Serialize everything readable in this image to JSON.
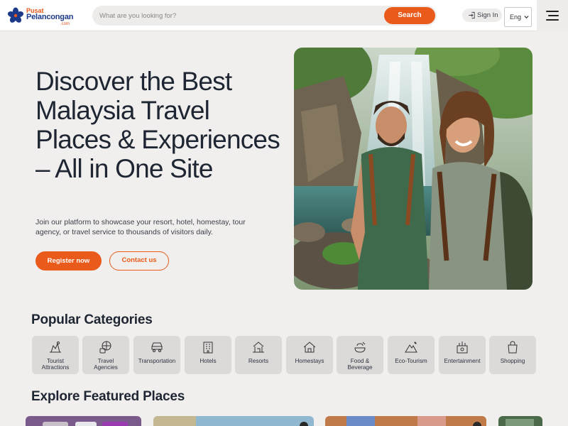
{
  "header": {
    "logo": {
      "line1": "Pusat",
      "line2": "Pelancongan",
      "line3": ".com"
    },
    "search": {
      "placeholder": "What are you looking for?",
      "button_label": "Search"
    },
    "signin_label": "Sign In",
    "language": {
      "selected": "Eng"
    },
    "icons": {
      "menu": "hamburger-menu-icon",
      "signin": "sign-in-icon",
      "dropdown": "chevron-down-icon",
      "logo": "hibiscus-icon"
    }
  },
  "hero": {
    "title": "Discover the Best Malaysia Travel Places & Experiences – All in One Site",
    "subtitle": "Join our platform to showcase your resort, hotel, homestay, tour agency, or travel service to thousands of visitors daily.",
    "register_label": "Register now",
    "contact_label": "Contact us"
  },
  "categories": {
    "title": "Popular Categories",
    "items": [
      {
        "line1": "Tourist",
        "line2": "Attractions",
        "icon": "attractions-icon"
      },
      {
        "line1": "Travel",
        "line2": "Agencies",
        "icon": "travel-agency-icon"
      },
      {
        "line1": "Transportation",
        "line2": "",
        "icon": "car-icon"
      },
      {
        "line1": "Hotels",
        "line2": "",
        "icon": "hotel-icon"
      },
      {
        "line1": "Resorts",
        "line2": "",
        "icon": "resort-icon"
      },
      {
        "line1": "Homestays",
        "line2": "",
        "icon": "homestay-icon"
      },
      {
        "line1": "Food &",
        "line2": "Beverage",
        "icon": "food-icon"
      },
      {
        "line1": "Eco-Tourism",
        "line2": "",
        "icon": "eco-tourism-icon"
      },
      {
        "line1": "Entertainment",
        "line2": "",
        "icon": "entertainment-icon"
      },
      {
        "line1": "Shopping",
        "line2": "",
        "icon": "shopping-bag-icon"
      }
    ]
  },
  "featured": {
    "title": "Explore Featured Places"
  },
  "colors": {
    "accent": "#ea5a1a",
    "brand_blue": "#1d3a8a",
    "background": "#f1efed",
    "tile": "#dcdad8"
  }
}
